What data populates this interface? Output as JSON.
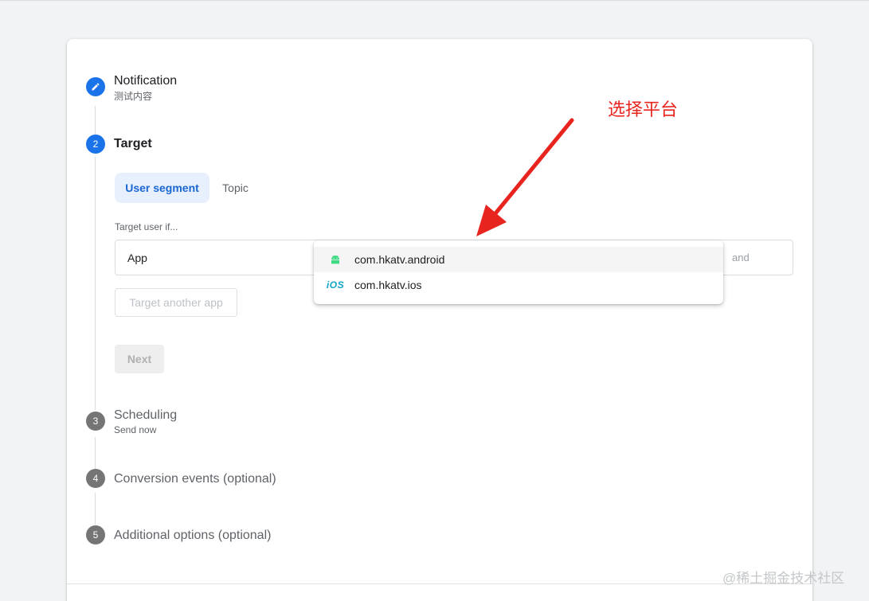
{
  "steps": [
    {
      "number": "",
      "title": "Notification",
      "subtitle": "测试内容",
      "state": "done"
    },
    {
      "number": "2",
      "title": "Target",
      "subtitle": "",
      "state": "active"
    },
    {
      "number": "3",
      "title": "Scheduling",
      "subtitle": "Send now",
      "state": "pending"
    },
    {
      "number": "4",
      "title": "Conversion events (optional)",
      "subtitle": "",
      "state": "pending"
    },
    {
      "number": "5",
      "title": "Additional options (optional)",
      "subtitle": "",
      "state": "pending"
    }
  ],
  "target": {
    "tabs": [
      {
        "label": "User segment",
        "selected": true
      },
      {
        "label": "Topic",
        "selected": false
      }
    ],
    "condition_label": "Target user if...",
    "app_field_label": "App",
    "and_label": "and",
    "target_another_app_label": "Target another app",
    "next_label": "Next"
  },
  "dropdown": {
    "options": [
      {
        "label": "com.hkatv.android",
        "icon": "android-icon",
        "highlighted": true
      },
      {
        "label": "com.hkatv.ios",
        "icon": "ios-icon",
        "highlighted": false
      }
    ],
    "ios_icon_text": "iOS"
  },
  "annotation": {
    "text": "选择平台",
    "color": "#e8241f"
  },
  "watermark": "@稀土掘金技术社区",
  "colors": {
    "accent": "#1a73e8",
    "selected_tab_bg": "#e8f0fe",
    "android_green": "#3ddc84",
    "ios_blue": "#12a4c9"
  }
}
